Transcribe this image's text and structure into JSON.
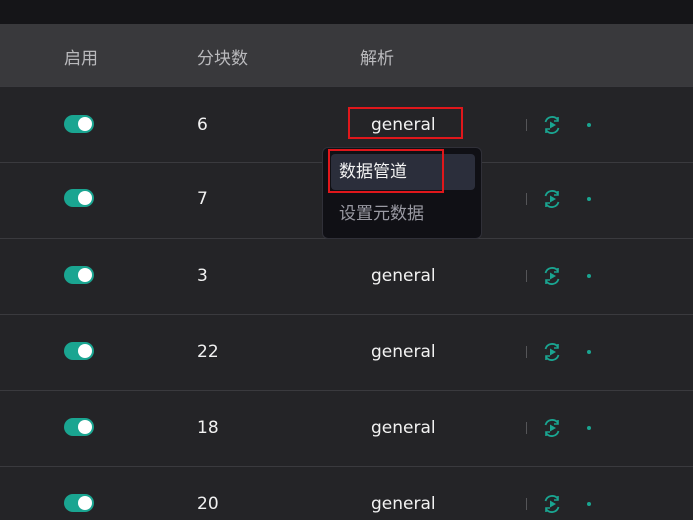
{
  "header": {
    "enabled_label": "启用",
    "chunks_label": "分块数",
    "parser_label": "解析"
  },
  "rows": [
    {
      "enabled": true,
      "chunks": "6",
      "parser": "general"
    },
    {
      "enabled": true,
      "chunks": "7",
      "parser": ""
    },
    {
      "enabled": true,
      "chunks": "3",
      "parser": "general"
    },
    {
      "enabled": true,
      "chunks": "22",
      "parser": "general"
    },
    {
      "enabled": true,
      "chunks": "18",
      "parser": "general"
    },
    {
      "enabled": true,
      "chunks": "20",
      "parser": "general"
    }
  ],
  "dropdown": {
    "items": [
      "数据管道",
      "设置元数据"
    ]
  },
  "icons": {
    "run": "run-icon",
    "more": "dot-icon"
  },
  "colors": {
    "accent": "#1aa591",
    "highlight": "#e0171b"
  }
}
